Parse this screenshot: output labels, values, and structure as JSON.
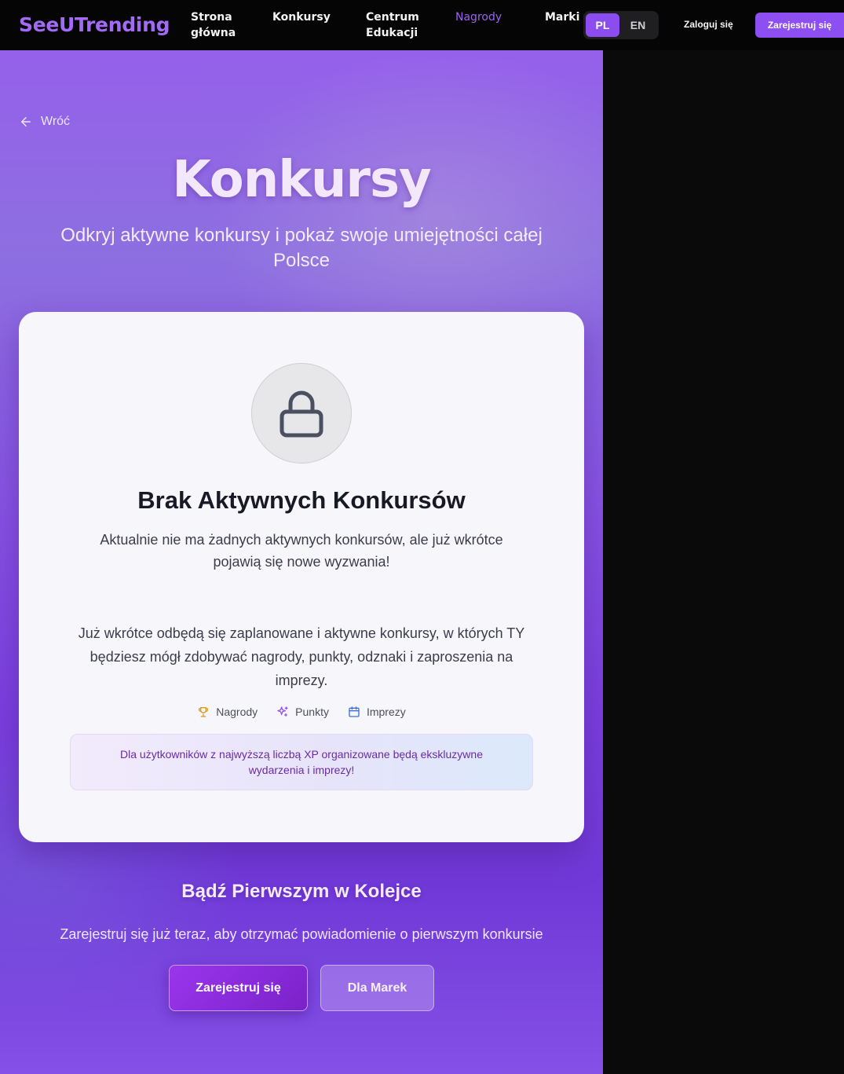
{
  "nav": {
    "logo": "SeeUTrending",
    "links": [
      {
        "label_line1": "Strona",
        "label_line2": "główna"
      },
      {
        "label_line1": "Konkursy",
        "label_line2": ""
      },
      {
        "label_line1": "Centrum",
        "label_line2": "Edukacji"
      },
      {
        "label_line1": "Nagrody",
        "label_line2": ""
      },
      {
        "label_line1": "Marki",
        "label_line2": ""
      }
    ],
    "active_link": "Nagrody",
    "languages": [
      "PL",
      "EN"
    ],
    "active_language": "PL",
    "login_label": "Zaloguj się",
    "signup_label": "Zarejestruj się"
  },
  "hero": {
    "back_label": "Wróć",
    "title": "Konkursy",
    "subtitle": "Odkryj aktywne konkursy i pokaż swoje umiejętności całej Polsce"
  },
  "card": {
    "icon": "lock-icon",
    "title": "Brak Aktywnych Konkursów",
    "description": "Aktualnie nie ma żadnych aktywnych konkursów, ale już wkrótce pojawią się nowe wyzwania!",
    "body": "Już wkrótce odbędą się zaplanowane i aktywne konkursy, w których TY będziesz mógł zdobywać nagrody, punkty, odznaki i zaproszenia na imprezy.",
    "features": [
      {
        "icon": "trophy-icon",
        "label": "Nagrody",
        "color": "#d99a1e"
      },
      {
        "icon": "sparkles-icon",
        "label": "Punkty",
        "color": "#9b4ff0"
      },
      {
        "icon": "calendar-icon",
        "label": "Imprezy",
        "color": "#3b6fe0"
      }
    ],
    "xp_note": "Dla użytkowników z najwyższą liczbą XP organizowane będą ekskluzywne wydarzenia i imprezy!"
  },
  "cta": {
    "title": "Bądź Pierwszym w Kolejce",
    "subtitle": "Zarejestruj się już teraz, aby otrzymać powiadomienie o pierwszym konkursie",
    "primary_label": "Zarejestruj się",
    "secondary_label": "Dla Marek"
  },
  "colors": {
    "accent": "#8b4cf0",
    "nav_bg": "#050505",
    "card_bg": "#f7f6fb"
  }
}
